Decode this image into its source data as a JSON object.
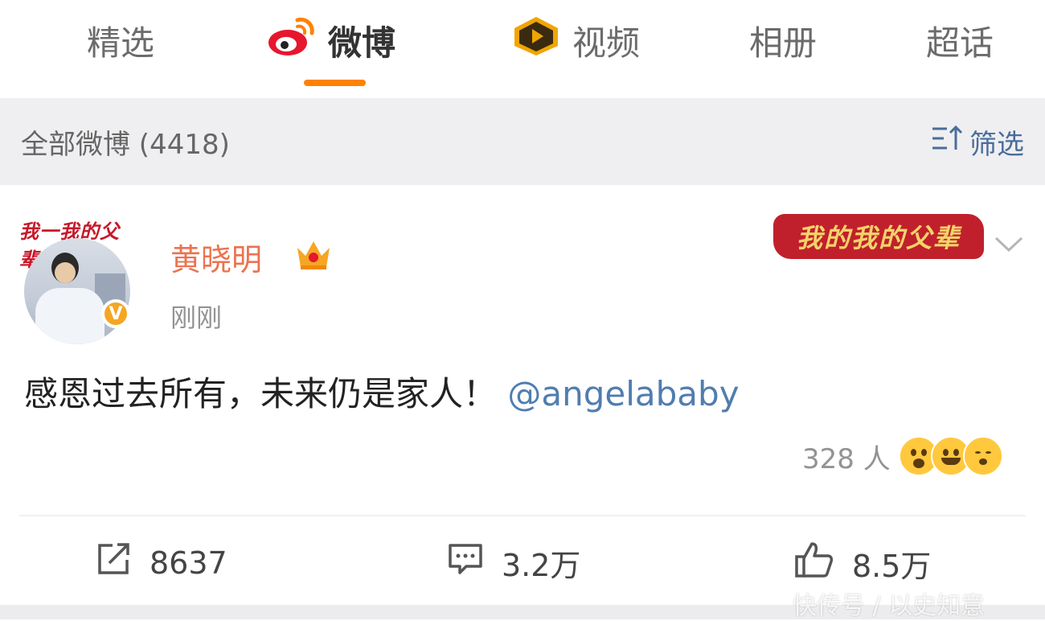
{
  "tabs": [
    {
      "label": "精选",
      "icon": "none",
      "active": false
    },
    {
      "label": "微博",
      "icon": "weibo-logo-icon",
      "active": true
    },
    {
      "label": "视频",
      "icon": "video-play-icon",
      "active": false
    },
    {
      "label": "相册",
      "icon": "none",
      "active": false
    },
    {
      "label": "超话",
      "icon": "none",
      "active": false
    }
  ],
  "accent_color": "#ff8200",
  "filter": {
    "title": "全部微博 (4418)",
    "button_label": "筛选",
    "button_icon": "filter-sort-icon"
  },
  "post": {
    "avatar_banner": "我一我的父辈",
    "avatar_badge": "V",
    "username": "黄晓明",
    "member_icon": "crown-icon",
    "timestamp": "刚刚",
    "promo_banner": "我的我的父辈",
    "menu_icon": "chevron-down-icon",
    "text": "感恩过去所有，未来仍是家人！",
    "mention": "@angelababy",
    "reactions": {
      "count": "328 人",
      "emojis": [
        "surprised-emoji-icon",
        "laugh-emoji-icon",
        "sleepy-emoji-icon"
      ]
    }
  },
  "actions": [
    {
      "icon": "repost-icon",
      "value": "8637"
    },
    {
      "icon": "comment-icon",
      "value": "3.2万"
    },
    {
      "icon": "like-icon",
      "value": "8.5万"
    }
  ],
  "watermark": "快传号 / 以史知意"
}
